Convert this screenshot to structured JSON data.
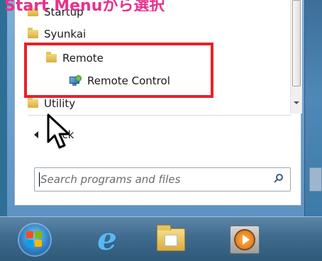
{
  "caption": "Start Menuから選択",
  "menu": {
    "items": [
      {
        "label": "Startup",
        "icon": "folder-icon"
      },
      {
        "label": "Syunkai",
        "icon": "folder-icon"
      },
      {
        "label": "Remote",
        "icon": "folder-icon"
      },
      {
        "label": "Remote Control",
        "icon": "remote-control-app-icon"
      },
      {
        "label": "Utility",
        "icon": "folder-icon"
      }
    ],
    "back_label": "Back",
    "search_placeholder": "Search programs and files"
  },
  "highlight_color": "#e8202a",
  "caption_color": "#e8318c",
  "taskbar": {
    "items": [
      "start-orb-icon",
      "internet-explorer-icon",
      "windows-explorer-icon",
      "media-player-icon"
    ]
  }
}
